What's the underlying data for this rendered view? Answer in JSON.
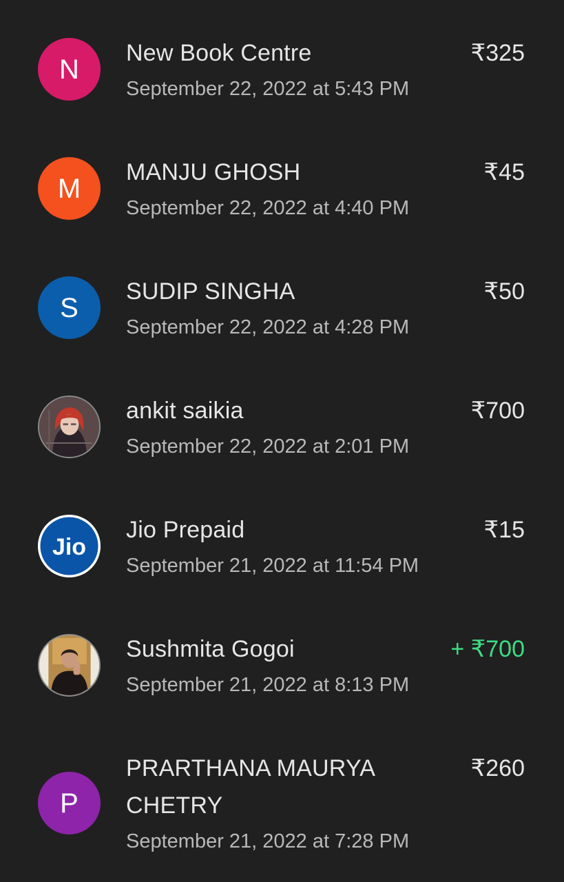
{
  "colors": {
    "background": "#202020",
    "text_primary": "#e6e6e6",
    "text_secondary": "#b9b9b9",
    "credit": "#3ddc84"
  },
  "transactions": [
    {
      "name": "New Book Centre",
      "date": "September 22, 2022 at 5:43 PM",
      "amount": "₹325",
      "avatar_letter": "N",
      "avatar_color": "#d81b69"
    },
    {
      "name": "MANJU GHOSH",
      "date": "September 22, 2022 at 4:40 PM",
      "amount": "₹45",
      "avatar_letter": "M",
      "avatar_color": "#f4511e"
    },
    {
      "name": "SUDIP SINGHA",
      "date": "September 22, 2022 at 4:28 PM",
      "amount": "₹50",
      "avatar_letter": "S",
      "avatar_color": "#0b5eac"
    },
    {
      "name": "ankit saikia",
      "date": "September 22, 2022 at 2:01 PM",
      "amount": "₹700",
      "avatar_icon": "profile-photo-icon"
    },
    {
      "name": "Jio Prepaid",
      "date": "September 21, 2022 at 11:54 PM",
      "amount": "₹15",
      "avatar_icon": "jio-logo-icon",
      "avatar_text": "Jio"
    },
    {
      "name": "Sushmita Gogoi",
      "date": "September 21, 2022 at 8:13 PM",
      "amount": "+ ₹700",
      "avatar_icon": "profile-photo-icon"
    },
    {
      "name": "PRARTHANA MAURYA CHETRY",
      "date": "September 21, 2022 at 7:28 PM",
      "amount": "₹260",
      "avatar_letter": "P",
      "avatar_color": "#8e24aa"
    }
  ]
}
